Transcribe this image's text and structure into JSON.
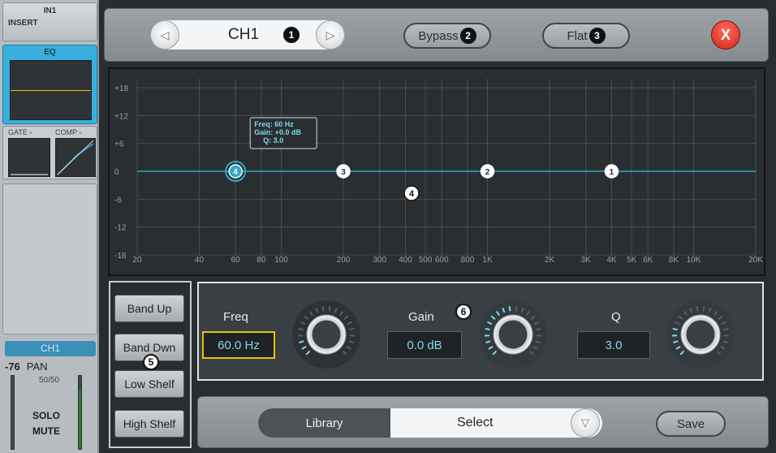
{
  "left_strip": {
    "channel_top": "IN1",
    "insert_label": "INSERT",
    "eq_label": "EQ",
    "gate_label": "GATE",
    "comp_label": "COMP",
    "channel_name": "CH1",
    "level": "-76",
    "pan_label": "PAN",
    "pan_value": "50/50",
    "solo_label": "SOLO",
    "mute_label": "MUTE"
  },
  "header": {
    "channel": "CH1",
    "callout_1": "1",
    "bypass_label": "Bypass",
    "callout_2": "2",
    "flat_label": "Flat",
    "callout_3": "3",
    "close_symbol": "X"
  },
  "graph": {
    "y_ticks": [
      "+18",
      "+12",
      "+6",
      "0",
      "-6",
      "-12",
      "-18"
    ],
    "x_ticks": [
      "20",
      "40",
      "60",
      "80",
      "100",
      "200",
      "300",
      "400",
      "500",
      "600",
      "800",
      "1K",
      "2K",
      "3K",
      "4K",
      "5K",
      "6K",
      "8K",
      "10K",
      "20K"
    ],
    "tooltip": {
      "freq": "Freq: 60 Hz",
      "gain": "Gain: +0.0 dB",
      "q": "Q: 3.0"
    },
    "bands": [
      {
        "label": "4",
        "freq_hz": 60,
        "gain_db": 0,
        "selected": true
      },
      {
        "label": "3",
        "freq_hz": 200,
        "gain_db": 0,
        "selected": false
      },
      {
        "label": "2",
        "freq_hz": 1000,
        "gain_db": 0,
        "selected": false
      },
      {
        "label": "1",
        "freq_hz": 4000,
        "gain_db": 0,
        "selected": false
      }
    ],
    "callout_4": "4"
  },
  "band_buttons": {
    "band_up": "Band Up",
    "band_down": "Band Dwn",
    "low_shelf": "Low Shelf",
    "high_shelf": "High Shelf",
    "callout_5": "5"
  },
  "params": {
    "freq_label": "Freq",
    "freq_value": "60.0 Hz",
    "gain_label": "Gain",
    "gain_value": "0.0 dB",
    "q_label": "Q",
    "q_value": "3.0",
    "callout_6": "6"
  },
  "bottom": {
    "library_label": "Library",
    "select_label": "Select",
    "save_label": "Save"
  },
  "colors": {
    "accent": "#3aaedc",
    "curve": "#2fa9c9",
    "highlight": "#e4c400",
    "close": "#d0251a"
  }
}
